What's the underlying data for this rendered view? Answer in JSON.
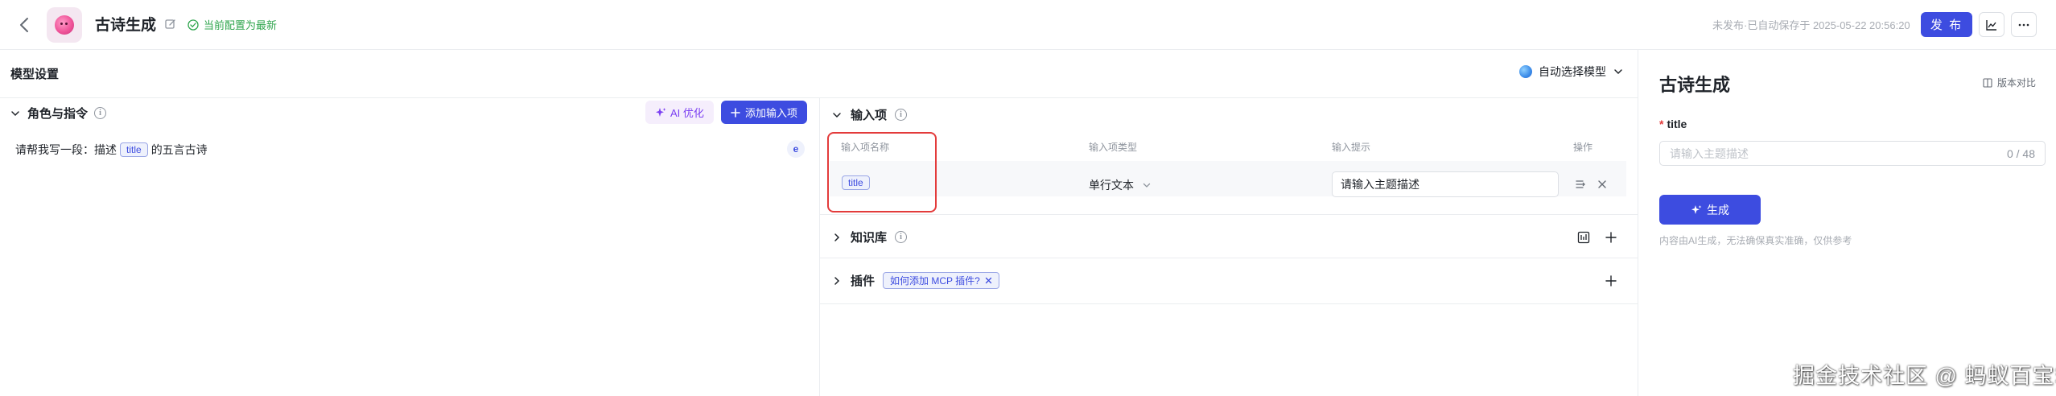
{
  "header": {
    "app_title": "古诗生成",
    "save_status": "当前配置为最新",
    "meta": "未发布·已自动保存于 2025-05-22 20:56:20",
    "publish_label": "发 布"
  },
  "model_bar": {
    "title": "模型设置",
    "model_select": "自动选择模型"
  },
  "role": {
    "title": "角色与指令",
    "ai_optimize_label": "AI 优化",
    "add_input_label": "添加输入项",
    "prompt_before": "请帮我写一段：描述",
    "prompt_var": "title",
    "prompt_after": "的五言古诗"
  },
  "inputs": {
    "title": "输入项",
    "columns": [
      "输入项名称",
      "输入项类型",
      "输入提示",
      "操作"
    ],
    "rows": [
      {
        "name": "title",
        "type": "单行文本",
        "hint": "请输入主题描述"
      }
    ]
  },
  "knowledge": {
    "title": "知识库"
  },
  "plugins": {
    "title": "插件",
    "mcp_tag": "如何添加 MCP 插件?"
  },
  "preview": {
    "title": "古诗生成",
    "compare_label": "版本对比",
    "field_label": "title",
    "field_placeholder": "请输入主题描述",
    "field_count": "0 / 48",
    "generate_label": "生成",
    "disclaimer": "内容由AI生成，无法确保真实准确，仅供参考"
  },
  "watermark": "掘金技术社区 @ 蚂蚁百宝箱"
}
